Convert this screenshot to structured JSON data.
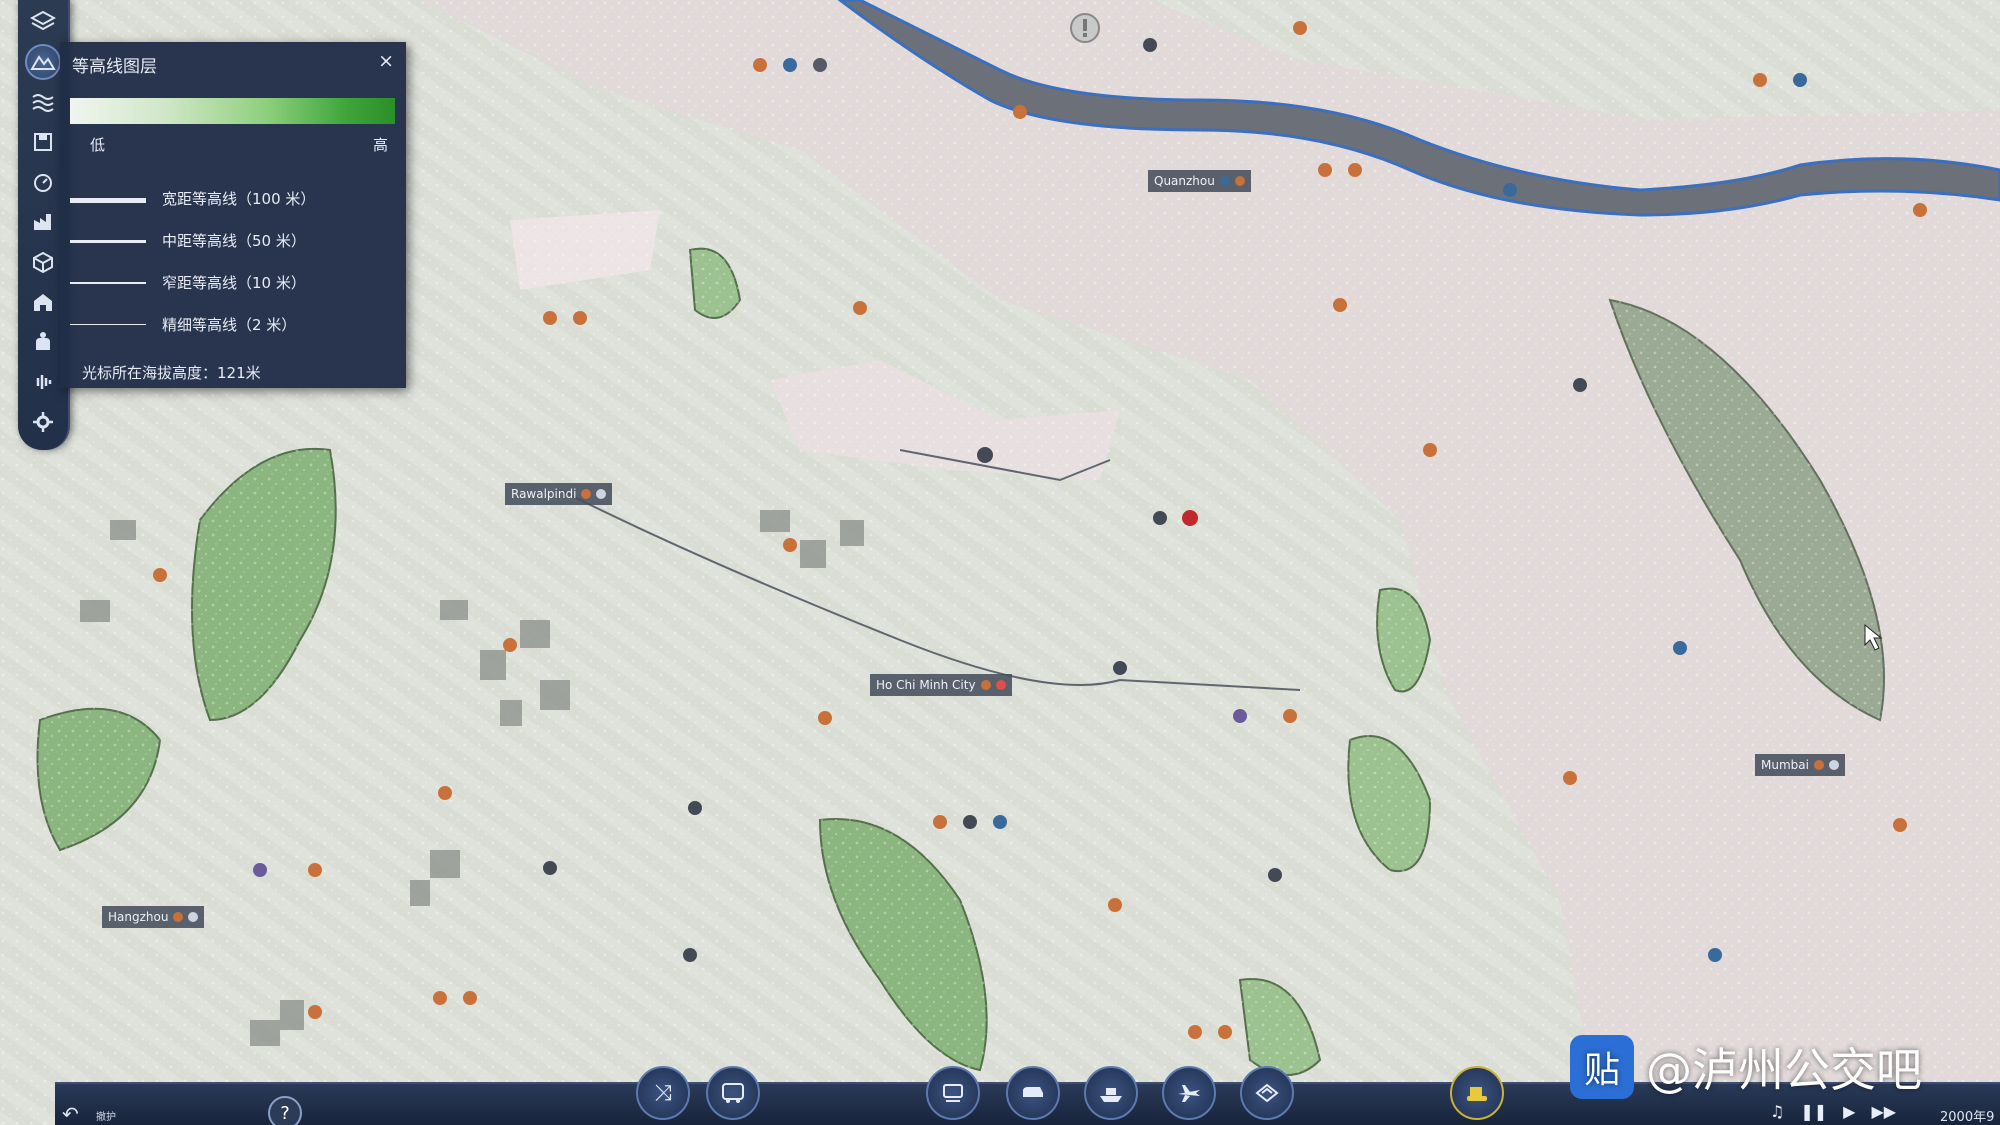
{
  "contour_panel": {
    "title": "等高线图层",
    "close_label": "×",
    "scale_low": "低",
    "scale_high": "高",
    "legend": [
      {
        "label": "宽距等高线（100 米）"
      },
      {
        "label": "中距等高线（50 米）"
      },
      {
        "label": "窄距等高线（10 米）"
      },
      {
        "label": "精细等高线（2 米）"
      }
    ],
    "elevation_text": "光标所在海拔高度：121米"
  },
  "cities": [
    {
      "name": "Quanzhou"
    },
    {
      "name": "Rawalpindi"
    },
    {
      "name": "Ho Chi Minh City"
    },
    {
      "name": "Mumbai"
    },
    {
      "name": "Hangzhou"
    }
  ],
  "toolbar_icons": [
    "layers-icon",
    "terrain-icon",
    "water-icon",
    "save-icon",
    "timer-icon",
    "industry-icon",
    "cargo-icon",
    "town-icon",
    "hand-icon",
    "sound-icon",
    "settings-icon"
  ],
  "bottom_bar": {
    "buttons": [
      "shuffle-icon",
      "bus-icon",
      "train-icon",
      "tram-icon",
      "ship-icon",
      "plane-icon",
      "terrain-tool-icon",
      "bulldozer-icon"
    ],
    "help_label": "?",
    "undo_label": "撤护",
    "date": "2000年9"
  },
  "watermark": {
    "badge": "贴",
    "text": "@泸州公交吧"
  },
  "colors": {
    "panel_bg": "#212e48",
    "toolbar_bg": "#2c3a52",
    "river": "#6b7079",
    "terrain_green": "#7fae73"
  }
}
